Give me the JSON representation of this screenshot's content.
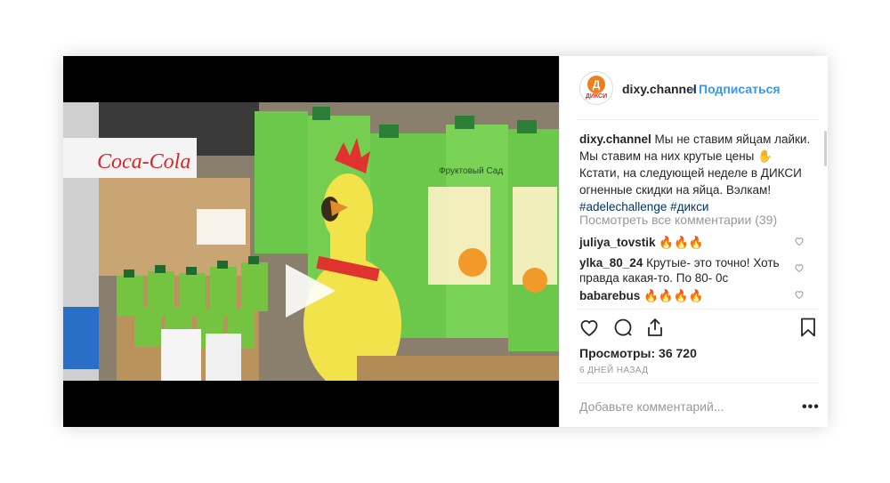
{
  "post": {
    "username": "dixy.channel",
    "dot": "•",
    "follow_label": "Подписаться",
    "avatar_logo": "Д",
    "avatar_text": "ДИКСИ",
    "caption_user": "dixy.channel",
    "caption_text": " Мы не ставим яйцам лайки. Мы ставим на них крутые цены ✋ Кстати, на следующей неделе в ДИКСИ огненные скидки на яйца. Вэлкам!",
    "caption_hashtags": "#adelechallenge #дикси",
    "view_all_comments": "Посмотреть все комментарии (39)",
    "comments": [
      {
        "user": "juliya_tovstik",
        "text": " 🔥🔥🔥"
      },
      {
        "user": "ylka_80_24",
        "text": " Крутые- это точно! Хоть правда какая-то. По 80- 0с"
      },
      {
        "user": "babarebus",
        "text": " 🔥🔥🔥🔥"
      }
    ],
    "views": "Просмотры: 36 720",
    "date": "6 ДНЕЙ НАЗАД",
    "add_comment_placeholder": "Добавьте комментарий...",
    "more_label": "•••"
  },
  "video_scene": {
    "brand_sign": "Coca-Cola",
    "box_title": "Фруктовый Сад"
  },
  "icons": {
    "like": "heart-icon",
    "comment": "comment-icon",
    "share": "share-icon",
    "save": "bookmark-icon",
    "play": "play-icon"
  },
  "colors": {
    "follow": "#3897f0",
    "muted": "#999999",
    "logo": "#f07f1a",
    "box_green": "#6cc84a"
  }
}
